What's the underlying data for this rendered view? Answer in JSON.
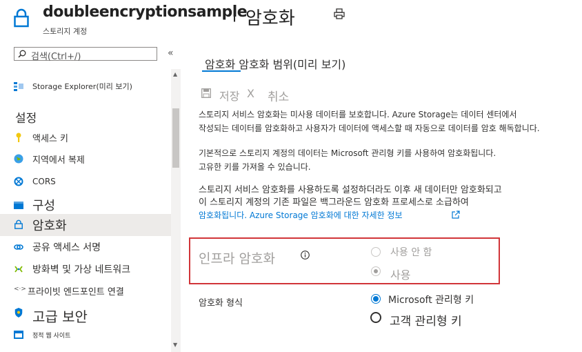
{
  "header": {
    "resource_name": "doubleencryptionsample",
    "separator": "|",
    "page_title": "암호화",
    "resource_type": "스토리지 계정"
  },
  "sidebar": {
    "search_placeholder": "검색(Ctrl+/)",
    "collapse_glyph": "«",
    "top_item": "Storage Explorer(미리 보기)",
    "section_settings": "설정",
    "items": [
      {
        "label": "액세스 키",
        "icon": "key-icon"
      },
      {
        "label": "지역에서 복제",
        "icon": "globe-icon"
      },
      {
        "label": "CORS",
        "icon": "cors-icon"
      },
      {
        "label": "구성",
        "icon": "configuration-icon"
      },
      {
        "label": "암호화",
        "icon": "lock-icon",
        "selected": true
      },
      {
        "label": "공유 액세스 서명",
        "icon": "link-icon"
      },
      {
        "label": "방화벽 및 가상 네트워크",
        "icon": "network-icon"
      },
      {
        "label": "프라이빗 엔드포인트 연결",
        "icon": "endpoint-icon"
      },
      {
        "label": "고급 보안",
        "icon": "shield-icon"
      },
      {
        "label": "정적 웹 사이트",
        "icon": "website-icon"
      }
    ]
  },
  "main": {
    "tabs": [
      "암호화 암호화 범위(미리 보기)"
    ],
    "toolbar": {
      "save": "저장",
      "save_x": "X",
      "cancel": "취소"
    },
    "para1": [
      "스토리지 서비스 암호화는 미사용 데이터를 보호합니다. Azure Storage는 데이터 센터에서",
      "작성되는 데이터를 암호화하고 사용자가 데이터에 액세스할 때 자동으로 데이터를 암호 해독합니다."
    ],
    "para2": [
      "기본적으로 스토리지 계정의 데이터는 Microsoft 관리형 키를 사용하여 암호화됩니다.",
      "고유한 키를 가져올 수 있습니다."
    ],
    "para3": [
      "스토리지 서비스 암호화를 사용하도록 설정하더라도 이후 새 데이터만 암호화되고",
      "이 스토리지 계정의 기존 파일은 백그라운드 암호화 프로세스로 소급하여"
    ],
    "para3_link": "암호화됩니다. Azure Storage 암호화에 대한 자세한 정보",
    "infra": {
      "label": "인프라 암호화",
      "options": [
        {
          "label": "사용 안 함",
          "selected": false
        },
        {
          "label": "사용",
          "selected": true
        }
      ]
    },
    "encryption_type": {
      "label": "암호화 형식",
      "options": [
        {
          "label": "Microsoft 관리형 키",
          "selected": true
        },
        {
          "label": "고객 관리형 키",
          "selected": false
        }
      ]
    }
  },
  "colors": {
    "accent": "#0078d4",
    "highlight_border": "#d13438",
    "disabled_text": "#a19f9d"
  }
}
